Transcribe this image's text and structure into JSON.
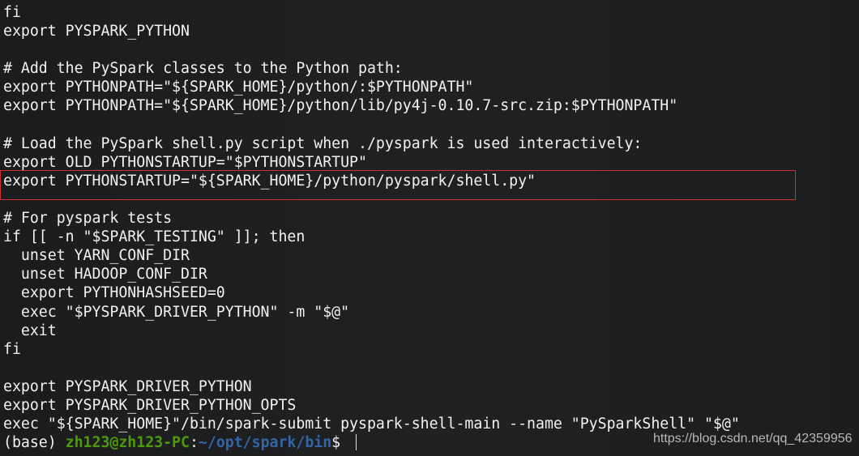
{
  "terminal": {
    "lines": [
      "fi",
      "export PYSPARK_PYTHON",
      "",
      "# Add the PySpark classes to the Python path:",
      "export PYTHONPATH=\"${SPARK_HOME}/python/:$PYTHONPATH\"",
      "export PYTHONPATH=\"${SPARK_HOME}/python/lib/py4j-0.10.7-src.zip:$PYTHONPATH\"",
      "",
      "# Load the PySpark shell.py script when ./pyspark is used interactively:",
      "export OLD_PYTHONSTARTUP=\"$PYTHONSTARTUP\"",
      "export PYTHONSTARTUP=\"${SPARK_HOME}/python/pyspark/shell.py\"",
      "",
      "# For pyspark tests",
      "if [[ -n \"$SPARK_TESTING\" ]]; then",
      "  unset YARN_CONF_DIR",
      "  unset HADOOP_CONF_DIR",
      "  export PYTHONHASHSEED=0",
      "  exec \"$PYSPARK_DRIVER_PYTHON\" -m \"$@\"",
      "  exit",
      "fi",
      "",
      "export PYSPARK_DRIVER_PYTHON",
      "export PYSPARK_DRIVER_PYTHON_OPTS",
      "exec \"${SPARK_HOME}\"/bin/spark-submit pyspark-shell-main --name \"PySparkShell\" \"$@\""
    ],
    "prompt": {
      "env": "(base) ",
      "user_host": "zh123@zh123-PC",
      "sep": ":",
      "path": "~/opt/spark/bin",
      "symbol": "$ "
    },
    "colors": {
      "background": "#1c1d1f",
      "text": "#f2f2f2",
      "user_host": "#4e9a06",
      "path": "#3465a4",
      "highlight_box": "#d0312d"
    }
  },
  "watermark": "https://blog.csdn.net/qq_42359956"
}
